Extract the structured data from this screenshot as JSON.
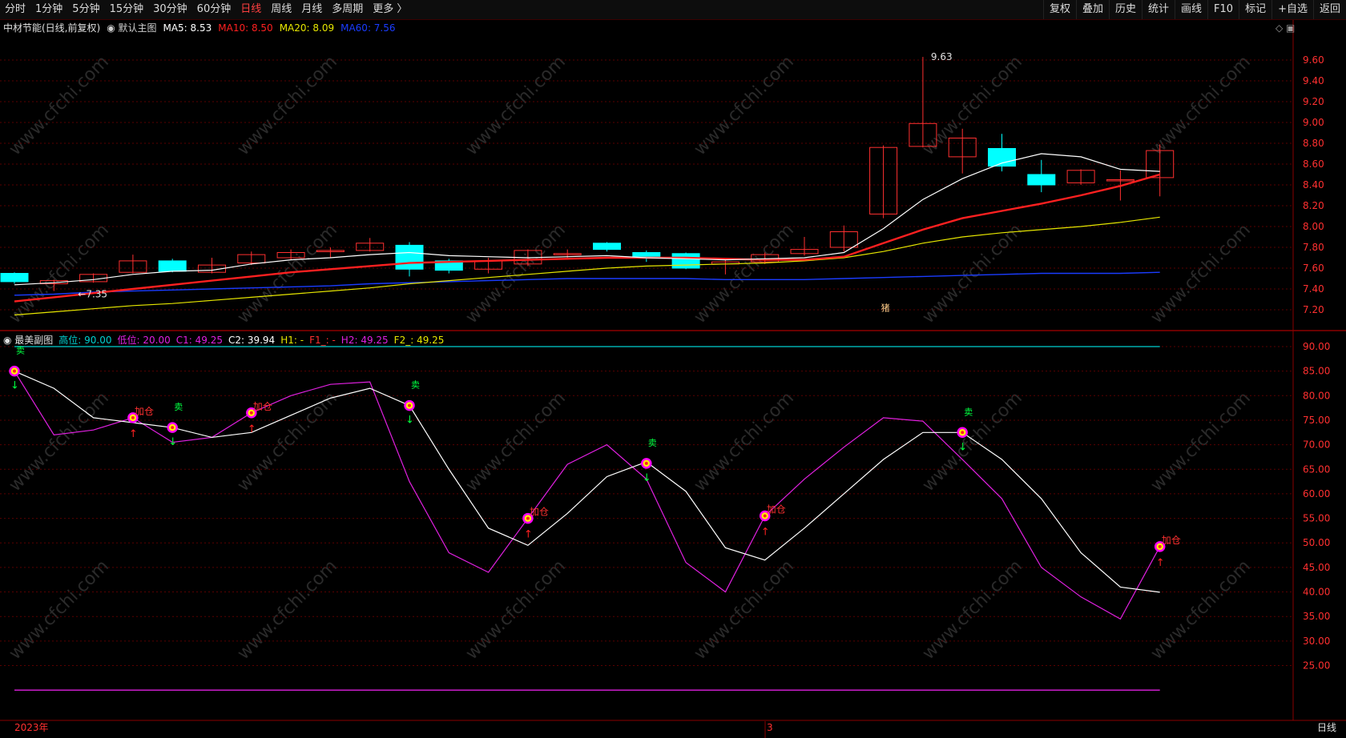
{
  "toolbar": {
    "timeframes": [
      "分时",
      "1分钟",
      "5分钟",
      "15分钟",
      "30分钟",
      "60分钟",
      "日线",
      "周线",
      "月线",
      "多周期",
      "更多 〉"
    ],
    "active_timeframe": "日线",
    "tools": [
      "复权",
      "叠加",
      "历史",
      "统计",
      "画线",
      "F10",
      "标记",
      "+自选",
      "返回"
    ]
  },
  "watermark": "www.cfchi.com",
  "colors": {
    "up": "#ff3030",
    "down": "#00ffff",
    "ma5": "#ffffff",
    "ma10": "#ff2020",
    "ma20": "#e6e600",
    "ma60": "#1a3cff",
    "grid": "#5a0000",
    "white_line": "#e8e8e8",
    "magenta": "#e020e0",
    "cyan_line": "#00d0d0"
  },
  "chart_data": [
    {
      "type": "candlestick",
      "title": "中材节能(日线,前复权)",
      "subtitle": "默认主图",
      "legend": [
        {
          "label": "MA5: 8.53",
          "color": "#ffffff"
        },
        {
          "label": "MA10: 8.50",
          "color": "#ff2020"
        },
        {
          "label": "MA20: 8.09",
          "color": "#e6e600"
        },
        {
          "label": "MA60: 7.56",
          "color": "#1a3cff"
        }
      ],
      "ylim": [
        7.1,
        9.7
      ],
      "yticks": [
        "9.60",
        "9.40",
        "9.20",
        "9.00",
        "8.80",
        "8.60",
        "8.40",
        "8.20",
        "8.00",
        "7.80",
        "7.60",
        "7.40",
        "7.20"
      ],
      "candles": [
        {
          "o": 7.55,
          "c": 7.47,
          "h": 7.56,
          "l": 7.45
        },
        {
          "o": 7.45,
          "c": 7.48,
          "h": 7.49,
          "l": 7.38
        },
        {
          "o": 7.47,
          "c": 7.54,
          "h": 7.55,
          "l": 7.46
        },
        {
          "o": 7.56,
          "c": 7.67,
          "h": 7.73,
          "l": 7.55
        },
        {
          "o": 7.67,
          "c": 7.57,
          "h": 7.69,
          "l": 7.56
        },
        {
          "o": 7.56,
          "c": 7.63,
          "h": 7.7,
          "l": 7.55
        },
        {
          "o": 7.65,
          "c": 7.73,
          "h": 7.76,
          "l": 7.63
        },
        {
          "o": 7.7,
          "c": 7.75,
          "h": 7.78,
          "l": 7.68
        },
        {
          "o": 7.76,
          "c": 7.77,
          "h": 7.8,
          "l": 7.7
        },
        {
          "o": 7.77,
          "c": 7.84,
          "h": 7.89,
          "l": 7.76
        },
        {
          "o": 7.82,
          "c": 7.59,
          "h": 7.85,
          "l": 7.52
        },
        {
          "o": 7.67,
          "c": 7.58,
          "h": 7.69,
          "l": 7.55
        },
        {
          "o": 7.59,
          "c": 7.67,
          "h": 7.7,
          "l": 7.55
        },
        {
          "o": 7.64,
          "c": 7.77,
          "h": 7.78,
          "l": 7.62
        },
        {
          "o": 7.73,
          "c": 7.74,
          "h": 7.78,
          "l": 7.7
        },
        {
          "o": 7.84,
          "c": 7.78,
          "h": 7.85,
          "l": 7.76
        },
        {
          "o": 7.75,
          "c": 7.7,
          "h": 7.77,
          "l": 7.66
        },
        {
          "o": 7.74,
          "c": 7.6,
          "h": 7.75,
          "l": 7.59
        },
        {
          "o": 7.64,
          "c": 7.66,
          "h": 7.68,
          "l": 7.54
        },
        {
          "o": 7.66,
          "c": 7.73,
          "h": 7.75,
          "l": 7.64
        },
        {
          "o": 7.74,
          "c": 7.78,
          "h": 7.9,
          "l": 7.72
        },
        {
          "o": 7.8,
          "c": 7.95,
          "h": 8.01,
          "l": 7.76
        },
        {
          "o": 8.12,
          "c": 8.76,
          "h": 8.78,
          "l": 8.08
        },
        {
          "o": 8.77,
          "c": 8.99,
          "h": 9.63,
          "l": 8.76
        },
        {
          "o": 8.67,
          "c": 8.85,
          "h": 8.94,
          "l": 8.51
        },
        {
          "o": 8.75,
          "c": 8.58,
          "h": 8.89,
          "l": 8.53
        },
        {
          "o": 8.5,
          "c": 8.4,
          "h": 8.64,
          "l": 8.33
        },
        {
          "o": 8.42,
          "c": 8.54,
          "h": 8.55,
          "l": 8.4
        },
        {
          "o": 8.44,
          "c": 8.45,
          "h": 8.54,
          "l": 8.25
        },
        {
          "o": 8.47,
          "c": 8.73,
          "h": 8.79,
          "l": 8.29
        }
      ],
      "ma5": [
        7.44,
        7.46,
        7.49,
        7.54,
        7.57,
        7.58,
        7.64,
        7.68,
        7.7,
        7.73,
        7.75,
        7.72,
        7.71,
        7.7,
        7.71,
        7.72,
        7.7,
        7.69,
        7.68,
        7.69,
        7.7,
        7.75,
        7.98,
        8.26,
        8.46,
        8.61,
        8.7,
        8.67,
        8.55,
        8.53
      ],
      "ma10": [
        7.28,
        7.32,
        7.36,
        7.4,
        7.44,
        7.48,
        7.52,
        7.56,
        7.59,
        7.62,
        7.65,
        7.66,
        7.67,
        7.68,
        7.69,
        7.7,
        7.7,
        7.7,
        7.69,
        7.68,
        7.68,
        7.71,
        7.84,
        7.97,
        8.08,
        8.15,
        8.22,
        8.3,
        8.39,
        8.5
      ],
      "ma20": [
        7.15,
        7.18,
        7.21,
        7.24,
        7.26,
        7.29,
        7.32,
        7.35,
        7.38,
        7.41,
        7.45,
        7.48,
        7.51,
        7.54,
        7.57,
        7.6,
        7.62,
        7.63,
        7.64,
        7.65,
        7.67,
        7.7,
        7.76,
        7.84,
        7.9,
        7.94,
        7.97,
        8.0,
        8.04,
        8.09
      ],
      "ma60": [
        7.34,
        7.35,
        7.37,
        7.38,
        7.39,
        7.4,
        7.41,
        7.42,
        7.43,
        7.45,
        7.46,
        7.47,
        7.48,
        7.49,
        7.5,
        7.5,
        7.5,
        7.5,
        7.49,
        7.49,
        7.49,
        7.5,
        7.51,
        7.52,
        7.53,
        7.54,
        7.55,
        7.55,
        7.55,
        7.56
      ],
      "annotations": [
        {
          "label": "9.63"
        },
        {
          "label": "7.35"
        },
        {
          "label": "猪"
        }
      ]
    },
    {
      "type": "line",
      "title": "最美副图",
      "legend": [
        {
          "label": "高位: 90.00",
          "color": "#00d0d0"
        },
        {
          "label": "低位: 20.00",
          "color": "#e020e0"
        },
        {
          "label": "C1: 49.25",
          "color": "#e020e0"
        },
        {
          "label": "C2: 39.94",
          "color": "#ffffff"
        },
        {
          "label": "H1: -",
          "color": "#e6e600"
        },
        {
          "label": "F1_: -",
          "color": "#ff3030"
        },
        {
          "label": "H2: 49.25",
          "color": "#e020e0"
        },
        {
          "label": "F2_: 49.25",
          "color": "#e6e600"
        }
      ],
      "ylim": [
        20,
        92
      ],
      "yticks": [
        "90.00",
        "85.00",
        "80.00",
        "75.00",
        "70.00",
        "65.00",
        "60.00",
        "55.00",
        "50.00",
        "45.00",
        "40.00",
        "35.00",
        "30.00",
        "25.00"
      ],
      "high_level": 90,
      "low_level": 20,
      "series": [
        {
          "name": "C1",
          "color": "#e020e0",
          "values": [
            85,
            72,
            73,
            75.5,
            70.5,
            71.5,
            76.5,
            80,
            82.3,
            82.8,
            62.5,
            48,
            44,
            55,
            66,
            70,
            63,
            46,
            40,
            55.5,
            63,
            69.5,
            75.5,
            74.8,
            67,
            59,
            45,
            39,
            34.5,
            49.25
          ]
        },
        {
          "name": "C2",
          "color": "#ffffff",
          "values": [
            85,
            81.5,
            75.5,
            74.5,
            73.5,
            71.5,
            72.5,
            76,
            79.5,
            81.5,
            78,
            65,
            53,
            49.5,
            56,
            63.5,
            66.5,
            60.5,
            49,
            46.5,
            53,
            60,
            67,
            72.5,
            72.5,
            67,
            59,
            48,
            41,
            39.94
          ]
        }
      ],
      "markers": [
        {
          "i": 0,
          "v": 85,
          "dot": true,
          "arrow": "down",
          "tag": "卖"
        },
        {
          "i": 3,
          "v": 75.5,
          "dot": true,
          "arrow": "up",
          "tag": "加仓"
        },
        {
          "i": 4,
          "v": 73.5,
          "dot": true,
          "arrow": "down",
          "tag": "卖"
        },
        {
          "i": 6,
          "v": 76.5,
          "dot": true,
          "arrow": "up",
          "tag": "加仓"
        },
        {
          "i": 10,
          "v": 78,
          "dot": true,
          "arrow": "down",
          "tag": "卖"
        },
        {
          "i": 13,
          "v": 55,
          "dot": true,
          "arrow": "up",
          "tag": "加仓"
        },
        {
          "i": 16,
          "v": 66.2,
          "dot": true,
          "arrow": "down",
          "tag": "卖"
        },
        {
          "i": 19,
          "v": 55.5,
          "dot": true,
          "arrow": "up",
          "tag": "加仓"
        },
        {
          "i": 24,
          "v": 72.5,
          "dot": true,
          "arrow": "down",
          "tag": "卖"
        },
        {
          "i": 29,
          "v": 49.25,
          "dot": true,
          "arrow": "up",
          "tag": "加仓"
        }
      ]
    }
  ],
  "time_axis": {
    "labels": [
      "2023年",
      "3"
    ],
    "period_label": "日线"
  }
}
